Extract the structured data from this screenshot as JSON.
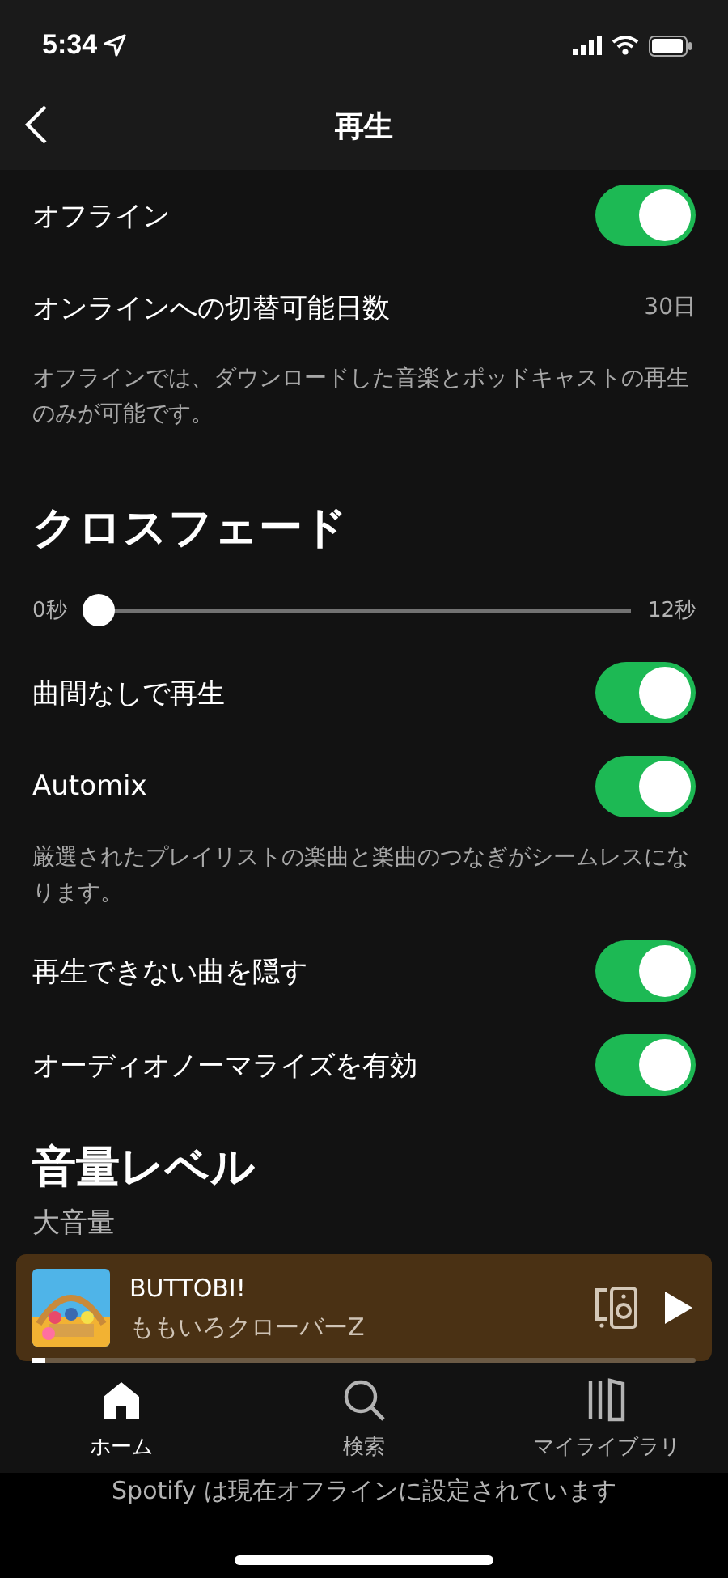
{
  "status_bar": {
    "time": "5:34"
  },
  "header": {
    "title": "再生"
  },
  "settings": [
    {
      "kind": "toggle",
      "label": "オフライン",
      "on": true
    },
    {
      "kind": "value",
      "label": "オンラインへの切替可能日数",
      "value": "30日"
    },
    {
      "kind": "note",
      "text": "オフラインでは、ダウンロードした音楽とポッドキャストの再生のみが可能です。"
    },
    {
      "kind": "heading",
      "text": "クロスフェード"
    },
    {
      "kind": "slider",
      "min_label": "0秒",
      "max_label": "12秒",
      "level": 0
    },
    {
      "kind": "toggle",
      "label": "曲間なしで再生",
      "on": true
    },
    {
      "kind": "toggle",
      "label": "Automix",
      "on": true
    },
    {
      "kind": "note",
      "text": "厳選されたプレイリストの楽曲と楽曲のつなぎがシームレスになります。"
    },
    {
      "kind": "toggle",
      "label": "再生できない曲を隠す",
      "on": true
    },
    {
      "kind": "toggle",
      "label": "オーディオノーマライズを有効",
      "on": true
    },
    {
      "kind": "heading",
      "text": "音量レベル"
    },
    {
      "kind": "label",
      "text": "大音量"
    }
  ],
  "now_playing": {
    "title": "BUTTOBI!",
    "artist": "ももいろクローバーZ",
    "level": 0.02
  },
  "tabs": [
    {
      "label": "ホーム",
      "selected": true
    },
    {
      "label": "検索",
      "selected": false
    },
    {
      "label": "マイライブラリ",
      "selected": false
    }
  ],
  "offline_banner": "Spotify は現在オフラインに設定されています"
}
